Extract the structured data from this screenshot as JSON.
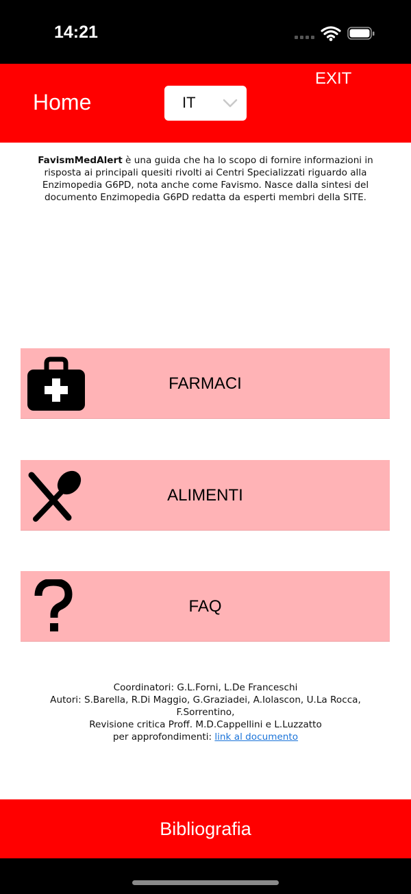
{
  "status_bar": {
    "time": "14:21",
    "icons": [
      "cellular-signal-icon",
      "wifi-icon",
      "battery-icon"
    ]
  },
  "header": {
    "title": "Home",
    "exit_label": "EXIT",
    "language": {
      "selected": "IT",
      "icon": "chevron-down-icon"
    },
    "background_color": "#ff0000"
  },
  "intro": {
    "app_name": "FavismMedAlert",
    "text": " è una guida che ha lo scopo di fornire informazioni in risposta ai principali quesiti rivolti ai Centri Specializzati riguardo alla Enzimopedia G6PD, nota anche come Favismo. Nasce dalla sintesi del documento Enzimopedia G6PD redatta da esperti membri della SITE."
  },
  "menu": [
    {
      "label": "FARMACI",
      "icon": "medical-kit-icon"
    },
    {
      "label": "ALIMENTI",
      "icon": "fork-spoon-icon"
    },
    {
      "label": "FAQ",
      "icon": "question-mark-icon"
    }
  ],
  "menu_color": "#ffb3b6",
  "credits": {
    "coordinators": "Coordinatori: G.L.Forni, L.De Franceschi",
    "authors": "Autori: S.Barella, R.Di Maggio, G.Graziadei, A.Iolascon, U.La Rocca, F.Sorrentino,",
    "review": "Revisione critica Proff. M.D.Cappellini e L.Luzzatto",
    "more_prefix": "per approfondimenti: ",
    "link_label": "link al documento"
  },
  "bottom_bar": {
    "label": "Bibliografia"
  }
}
